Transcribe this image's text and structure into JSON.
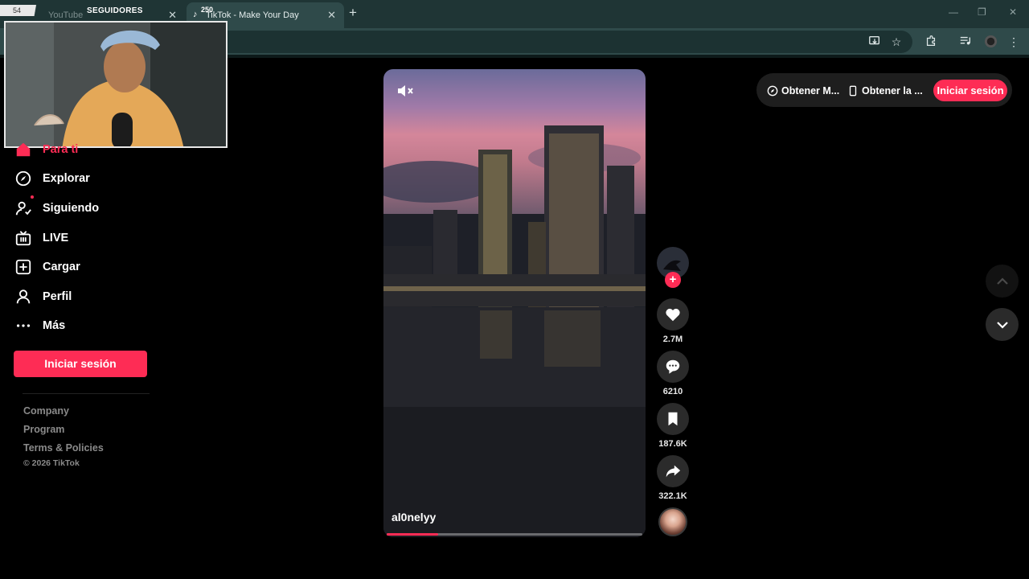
{
  "browser": {
    "tabs": [
      {
        "title": "YouTube"
      },
      {
        "title": "TikTok - Make Your Day"
      }
    ],
    "close_glyph": "✕",
    "new_tab_glyph": "+"
  },
  "overlay": {
    "left_tag": "54",
    "label": "SEGUIDORES",
    "count": "250"
  },
  "sidebar": {
    "items": [
      {
        "label": "Para ti",
        "icon": "home-icon",
        "active": true
      },
      {
        "label": "Explorar",
        "icon": "compass-icon"
      },
      {
        "label": "Siguiendo",
        "icon": "following-icon"
      },
      {
        "label": "LIVE",
        "icon": "live-icon"
      },
      {
        "label": "Cargar",
        "icon": "upload-icon"
      },
      {
        "label": "Perfil",
        "icon": "profile-icon"
      },
      {
        "label": "Más",
        "icon": "more-icon"
      }
    ],
    "login_label": "Iniciar sesión",
    "footer_links": [
      "Company",
      "Program",
      "Terms & Policies"
    ],
    "copyright": "© 2026 TikTok"
  },
  "video": {
    "author": "al0nelyy",
    "progress": 0.2,
    "accent_color": "#fe2c55"
  },
  "actions": {
    "likes": "2.7M",
    "comments": "6210",
    "saves": "187.6K",
    "shares": "322.1K"
  },
  "top_bar": {
    "get_app_label": "Obtener M...",
    "get_mobile_label": "Obtener la ...",
    "login_label": "Iniciar sesión"
  }
}
